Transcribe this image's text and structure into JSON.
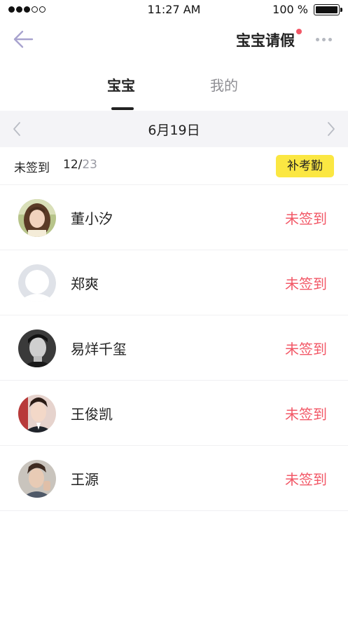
{
  "status_bar": {
    "time": "11:27 AM",
    "battery": "100 %"
  },
  "nav": {
    "title": "宝宝请假",
    "back_icon": "arrow-left-icon",
    "more_icon": "more-horizontal-icon"
  },
  "tabs": [
    {
      "label": "宝宝",
      "active": true
    },
    {
      "label": "我的",
      "active": false
    }
  ],
  "date_bar": {
    "date": "6月19日",
    "prev_icon": "chevron-left-icon",
    "next_icon": "chevron-right-icon"
  },
  "summary": {
    "label": "未签到",
    "done": "12/",
    "total": "23",
    "makeup_button": "补考勤"
  },
  "students": [
    {
      "name": "董小汐",
      "status": "未签到",
      "avatar": "photo"
    },
    {
      "name": "郑爽",
      "status": "未签到",
      "avatar": "placeholder"
    },
    {
      "name": "易烊千玺",
      "status": "未签到",
      "avatar": "photo"
    },
    {
      "name": "王俊凯",
      "status": "未签到",
      "avatar": "photo"
    },
    {
      "name": "王源",
      "status": "未签到",
      "avatar": "photo"
    }
  ],
  "colors": {
    "accent_red": "#f25867",
    "button_yellow": "#fbe742",
    "date_bar_bg": "#f4f4f7"
  }
}
